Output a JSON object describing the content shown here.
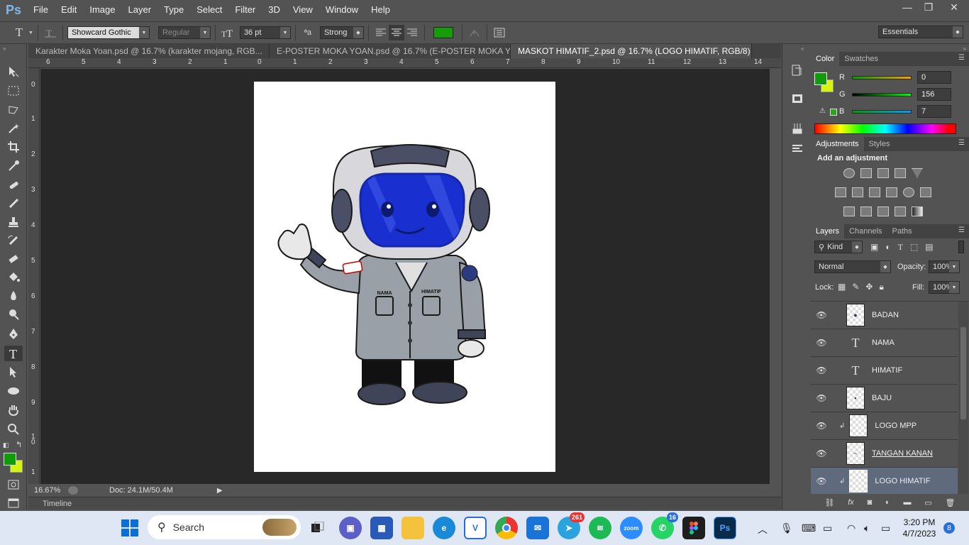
{
  "app": {
    "logo": "Ps"
  },
  "menu": [
    "File",
    "Edit",
    "Image",
    "Layer",
    "Type",
    "Select",
    "Filter",
    "3D",
    "View",
    "Window",
    "Help"
  ],
  "window_controls": {
    "minimize": "—",
    "restore": "❐",
    "close": "✕"
  },
  "options": {
    "font_family": "Showcard Gothic",
    "font_style": "Regular",
    "font_size": "36 pt",
    "anti_alias": "Strong",
    "text_color": "#159c07",
    "workspace": "Essentials"
  },
  "tabs": [
    {
      "label": "Karakter Moka Yoan.psd @ 16.7% (karakter mojang, RGB..."
    },
    {
      "label": "E-POSTER MOKA YOAN.psd @ 16.7% (E-POSTER MOKA Y..."
    },
    {
      "label": "MASKOT HIMATIF_2.psd @ 16.7% (LOGO HIMATIF, RGB/8)"
    }
  ],
  "rulers": {
    "horizontal": [
      "6",
      "5",
      "4",
      "3",
      "2",
      "1",
      "0",
      "1",
      "2",
      "3",
      "4",
      "5",
      "6",
      "7",
      "8",
      "9",
      "10",
      "11",
      "12",
      "13",
      "14"
    ],
    "vertical": [
      "0",
      "1",
      "2",
      "3",
      "4",
      "5",
      "6",
      "7",
      "8",
      "9",
      "1\n0",
      "1"
    ]
  },
  "status": {
    "zoom": "16.67%",
    "doc": "Doc: 24.1M/50.4M"
  },
  "timeline_label": "Timeline",
  "color_panel": {
    "tabs": [
      "Color",
      "Swatches"
    ],
    "r": "0",
    "g": "156",
    "b": "7",
    "r_label": "R",
    "g_label": "G",
    "b_label": "B",
    "fg": "#109c0a",
    "bg": "#d8f40e"
  },
  "adjustments_panel": {
    "tabs": [
      "Adjustments",
      "Styles"
    ],
    "hint": "Add an adjustment"
  },
  "layers_panel": {
    "tabs": [
      "Layers",
      "Channels",
      "Paths"
    ],
    "filter": "Kind",
    "blend_mode": "Normal",
    "opacity_label": "Opacity:",
    "opacity": "100%",
    "lock_label": "Lock:",
    "fill_label": "Fill:",
    "fill": "100%",
    "layers": [
      {
        "name": "BADAN",
        "kind": "image"
      },
      {
        "name": "NAMA",
        "kind": "text"
      },
      {
        "name": "HIMATIF",
        "kind": "text"
      },
      {
        "name": "BAJU",
        "kind": "image"
      },
      {
        "name": "LOGO MPP",
        "kind": "clipped"
      },
      {
        "name": "TANGAN KANAN",
        "kind": "image"
      },
      {
        "name": "LOGO HIMATIF",
        "kind": "clipped"
      }
    ]
  },
  "mascot": {
    "left_label": "NAMA",
    "right_label": "HIMATIF"
  },
  "taskbar": {
    "search_placeholder": "Search",
    "telegram_badge": "261",
    "whatsapp_badge": "16",
    "notification_count": "8",
    "zoom_label": "zoom",
    "time": "3:20 PM",
    "date": "4/7/2023"
  }
}
